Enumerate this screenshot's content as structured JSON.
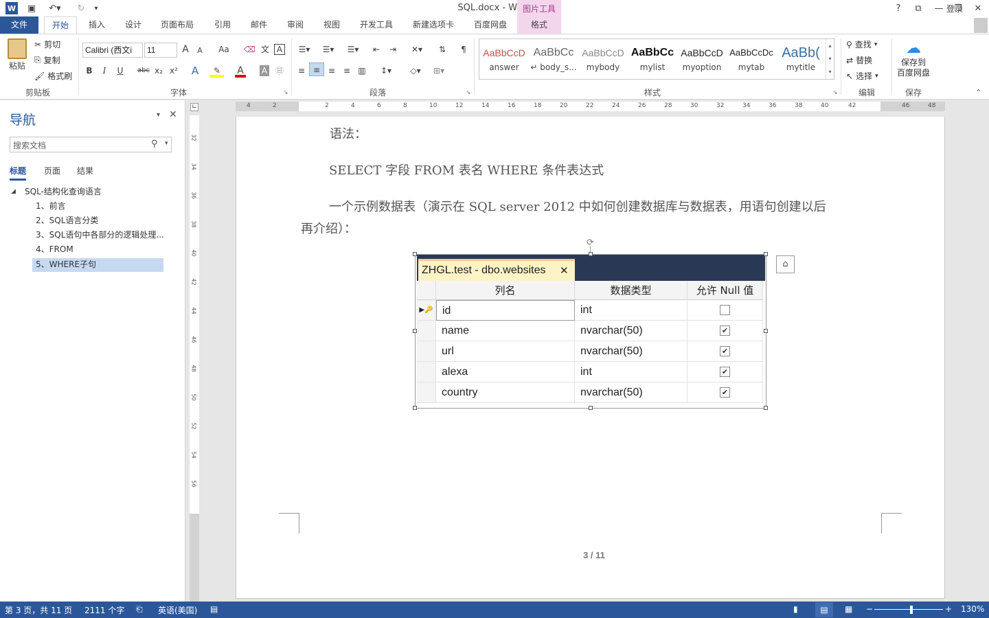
{
  "window": {
    "title": "SQL.docx - Word",
    "contextual_group": "图片工具",
    "login": "登录",
    "help": "?",
    "restore_ribbon": "⧉",
    "minimize": "—",
    "maximize": "❐",
    "close": "✕"
  },
  "tabs": [
    "文件",
    "开始",
    "插入",
    "设计",
    "页面布局",
    "引用",
    "邮件",
    "审阅",
    "视图",
    "开发工具",
    "新建选项卡",
    "百度网盘",
    "格式"
  ],
  "clipboard": {
    "paste": "粘贴",
    "cut": "剪切",
    "copy": "复制",
    "format_painter": "格式刷",
    "label": "剪贴板"
  },
  "font": {
    "name": "Calibri (西文i",
    "size": "11",
    "grow": "A",
    "shrink": "A",
    "case": "Aa",
    "bold": "B",
    "italic": "I",
    "underline": "U",
    "strike": "abc",
    "sub": "x₂",
    "sup": "x²",
    "label": "字体"
  },
  "paragraph": {
    "label": "段落"
  },
  "styles": {
    "label": "样式",
    "items": [
      {
        "preview": "AaBbCcD",
        "name": "answer",
        "color": "#c0504d"
      },
      {
        "preview": "AaBbCc",
        "name": "↵ body_s...",
        "color": "#666666"
      },
      {
        "preview": "AaBbCcD",
        "name": "mybody",
        "color": "#888888"
      },
      {
        "preview": "AaBbCc",
        "name": "mylist",
        "color": "#111111"
      },
      {
        "preview": "AaBbCcD",
        "name": "myoption",
        "color": "#222222"
      },
      {
        "preview": "AaBbCcDc",
        "name": "mytab",
        "color": "#222222"
      },
      {
        "preview": "AaBb(",
        "name": "mytitle",
        "color": "#3a6ea5"
      }
    ]
  },
  "editing": {
    "find": "查找",
    "replace": "替换",
    "select": "选择",
    "label": "编辑"
  },
  "save": {
    "line1": "保存到",
    "line2": "百度网盘",
    "label": "保存"
  },
  "nav": {
    "title": "导航",
    "search_placeholder": "搜索文档",
    "tabs": [
      "标题",
      "页面",
      "结果"
    ],
    "root": "SQL-结构化查询语言",
    "items": [
      "1、前言",
      "2、SQL语言分类",
      "3、SQL语句中各部分的逻辑处理...",
      "4、FROM",
      "5、WHERE子句"
    ]
  },
  "ruler": {
    "h": [
      "4",
      "2",
      "2",
      "4",
      "6",
      "8",
      "10",
      "12",
      "14",
      "16",
      "18",
      "20",
      "22",
      "24",
      "26",
      "28",
      "30",
      "32",
      "34",
      "36",
      "38",
      "40",
      "42",
      "46",
      "48"
    ],
    "v": [
      "32",
      "34",
      "36",
      "38",
      "40",
      "42",
      "44",
      "46",
      "48",
      "50",
      "52",
      "54",
      "56",
      "60",
      "62",
      "64"
    ]
  },
  "document": {
    "line1": "语法：",
    "line2": "SELECT  字段  FROM  表名  WHERE  条件表达式",
    "line3": "一个示例数据表（演示在 SQL server 2012 中如何创建数据库与数据表，用语句创建以后",
    "line4": "再介绍）：",
    "page_number": "3 / 11"
  },
  "ssms": {
    "tab_title": "ZHGL.test - dbo.websites",
    "columns": [
      "列名",
      "数据类型",
      "允许 Null 值"
    ],
    "rows": [
      {
        "name": "id",
        "type": "int",
        "nullable": false,
        "key": true
      },
      {
        "name": "name",
        "type": "nvarchar(50)",
        "nullable": true,
        "key": false
      },
      {
        "name": "url",
        "type": "nvarchar(50)",
        "nullable": true,
        "key": false
      },
      {
        "name": "alexa",
        "type": "int",
        "nullable": true,
        "key": false
      },
      {
        "name": "country",
        "type": "nvarchar(50)",
        "nullable": true,
        "key": false
      }
    ]
  },
  "status": {
    "page": "第 3 页，共 11 页",
    "words": "2111 个字",
    "language": "英语(美国)",
    "zoom": "130%",
    "zoom_minus": "−",
    "zoom_plus": "+"
  }
}
